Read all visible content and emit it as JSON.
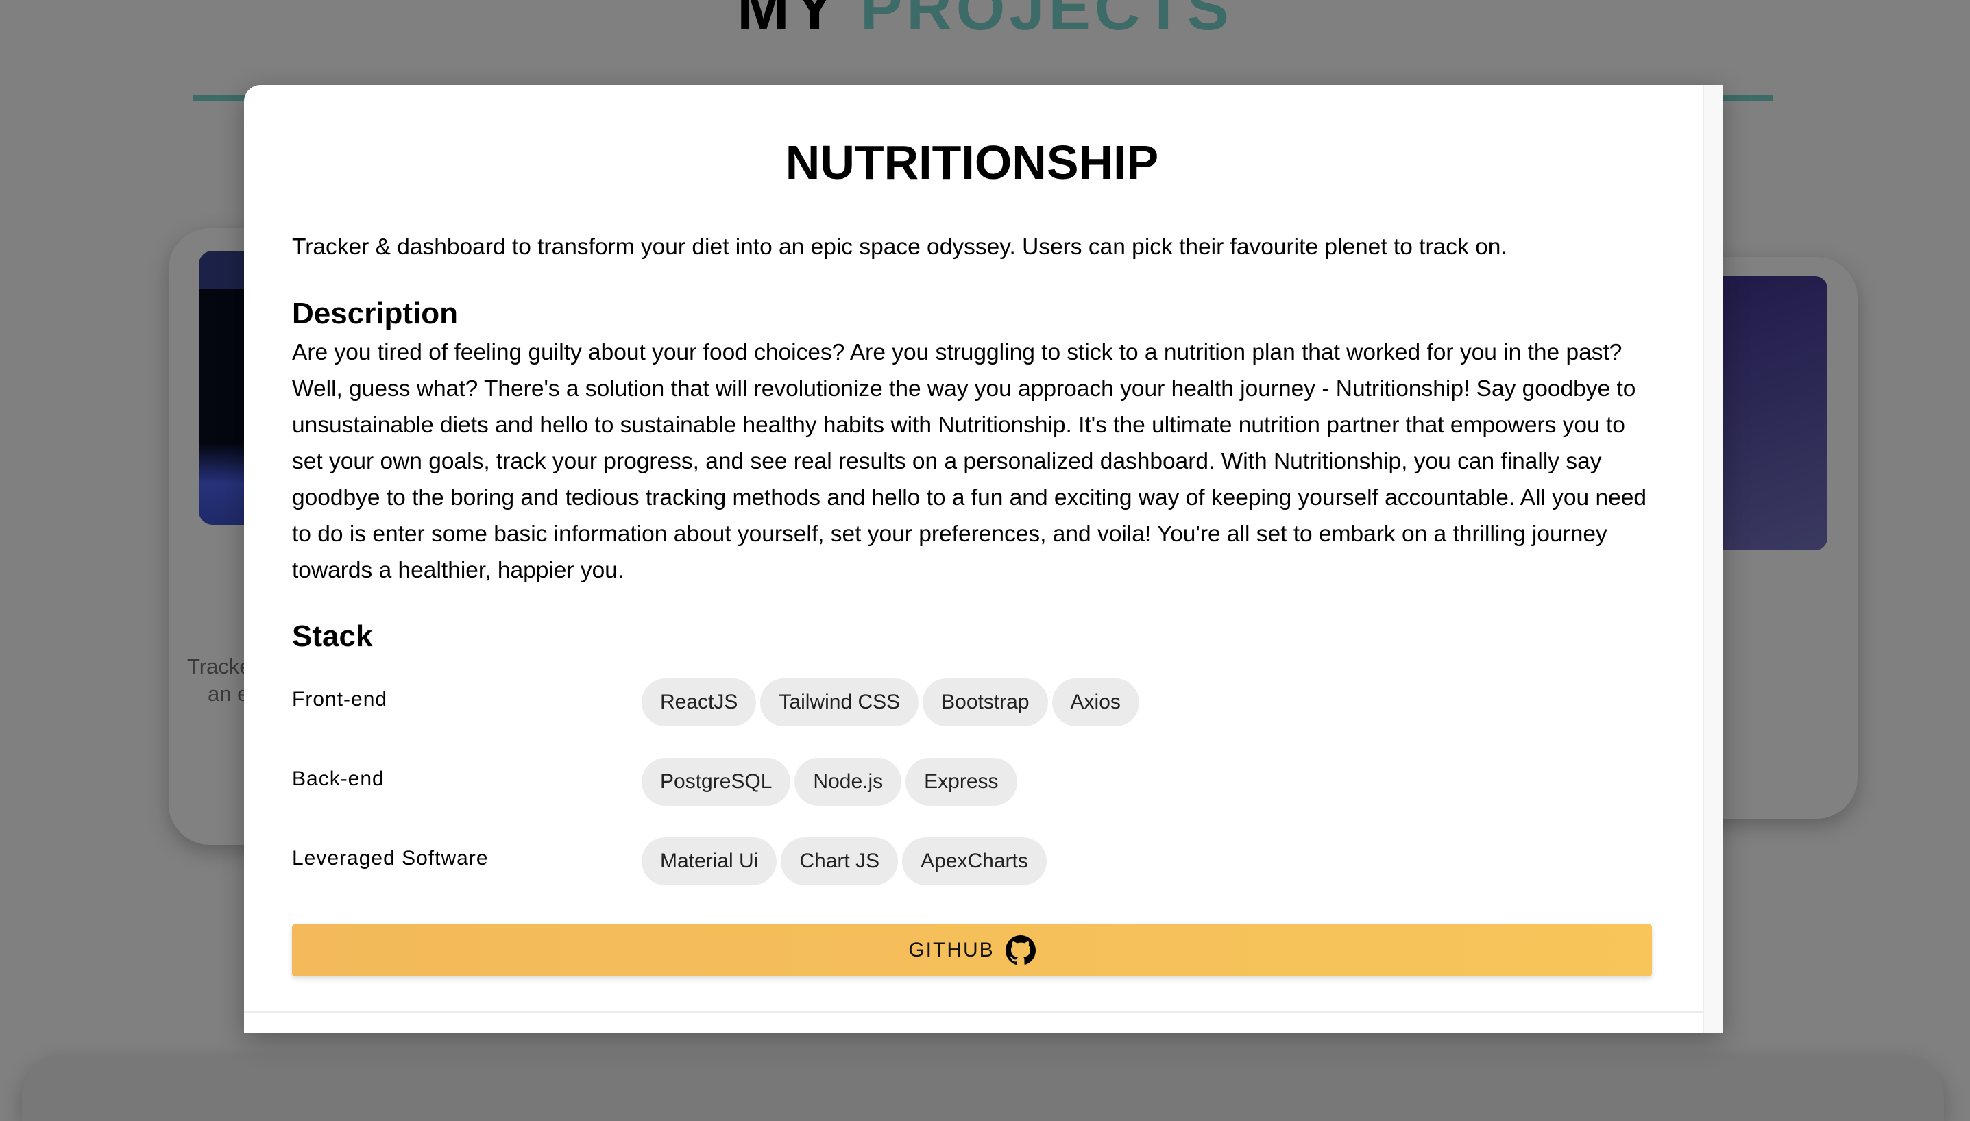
{
  "background": {
    "title_part1": "MY",
    "title_part2": "PROJECTS",
    "card_left_text": [
      "Tracker &",
      "an epic"
    ]
  },
  "modal": {
    "title": "NUTRITIONSHIP",
    "tagline": "Tracker & dashboard to transform your diet into an epic space odyssey. Users can pick their favourite plenet to track on.",
    "description_heading": "Description",
    "description": "Are you tired of feeling guilty about your food choices? Are you struggling to stick to a nutrition plan that worked for you in the past? Well, guess what? There's a solution that will revolutionize the way you approach your health journey - Nutritionship! Say goodbye to unsustainable diets and hello to sustainable healthy habits with Nutritionship. It's the ultimate nutrition partner that empowers you to set your own goals, track your progress, and see real results on a personalized dashboard. With Nutritionship, you can finally say goodbye to the boring and tedious tracking methods and hello to a fun and exciting way of keeping yourself accountable. All you need to do is enter some basic information about yourself, set your preferences, and voila! You're all set to embark on a thrilling journey towards a healthier, happier you.",
    "stack_heading": "Stack",
    "stack": [
      {
        "label": "Front-end",
        "items": [
          "ReactJS",
          "Tailwind CSS",
          "Bootstrap",
          "Axios"
        ]
      },
      {
        "label": "Back-end",
        "items": [
          "PostgreSQL",
          "Node.js",
          "Express"
        ]
      },
      {
        "label": "Leveraged Software",
        "items": [
          "Material Ui",
          "Chart JS",
          "ApexCharts"
        ]
      }
    ],
    "github_label": "GITHUB",
    "github_icon": "github-icon"
  },
  "colors": {
    "accent": "#3d6b68",
    "button": "#f5bd5a",
    "chip": "#ebebeb"
  }
}
